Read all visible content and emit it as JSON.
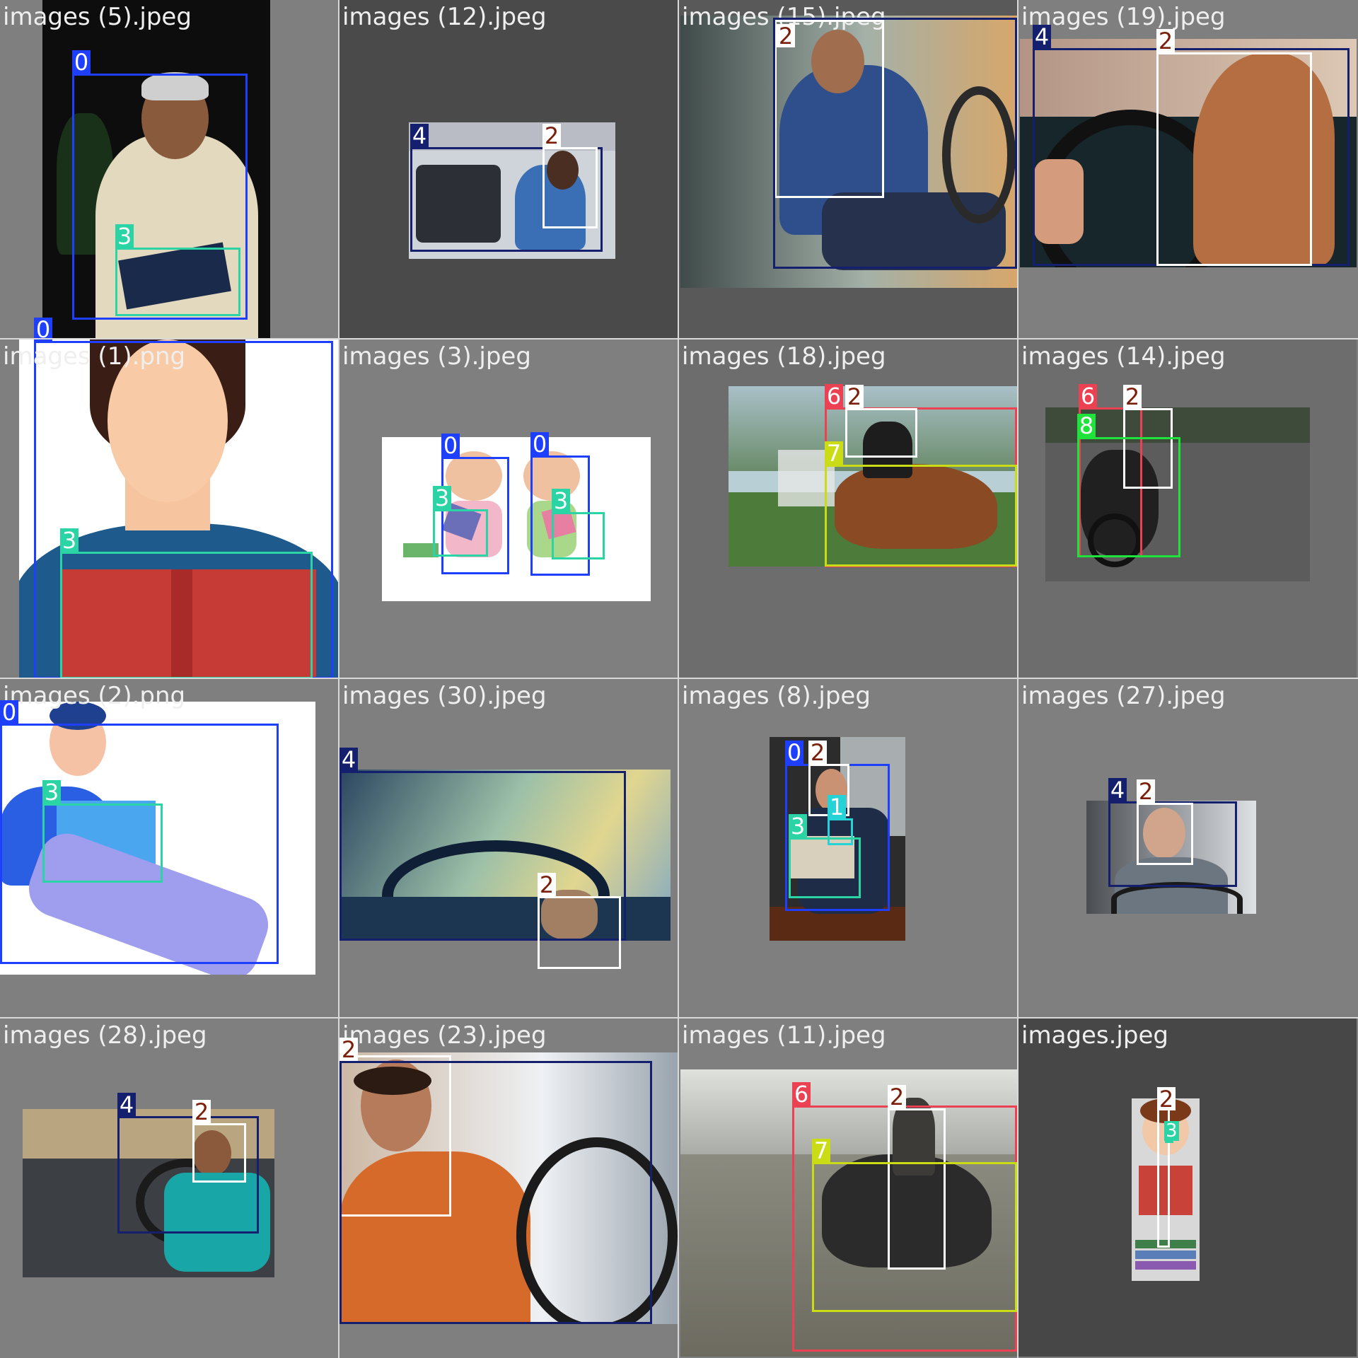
{
  "colors": {
    "0": "#1f3fff",
    "1": "#25d3d6",
    "2": "#ffffff",
    "3": "#2ad4a4",
    "4": "#14206e",
    "6": "#ec4152",
    "7": "#c9dc16",
    "8": "#1ee33a",
    "tag_text_2": "#7a1f0a",
    "bg": "#7f7f7f"
  },
  "cells": [
    {
      "filename": "images (5).jpeg",
      "boxes": [
        {
          "label": "0"
        },
        {
          "label": "3"
        }
      ]
    },
    {
      "filename": "images (12).jpeg",
      "boxes": [
        {
          "label": "4"
        },
        {
          "label": "2"
        }
      ]
    },
    {
      "filename": "images (15).jpeg",
      "boxes": [
        {
          "label": "2"
        }
      ]
    },
    {
      "filename": "images (19).jpeg",
      "boxes": [
        {
          "label": "4"
        },
        {
          "label": "2"
        }
      ]
    },
    {
      "filename": "images (1).png",
      "boxes": [
        {
          "label": "0"
        },
        {
          "label": "3"
        }
      ]
    },
    {
      "filename": "images (3).jpeg",
      "boxes": [
        {
          "label": "0"
        },
        {
          "label": "0"
        },
        {
          "label": "3"
        },
        {
          "label": "3"
        }
      ]
    },
    {
      "filename": "images (18).jpeg",
      "boxes": [
        {
          "label": "6"
        },
        {
          "label": "2"
        },
        {
          "label": "7"
        }
      ]
    },
    {
      "filename": "images (14).jpeg",
      "boxes": [
        {
          "label": "6"
        },
        {
          "label": "2"
        },
        {
          "label": "8"
        }
      ]
    },
    {
      "filename": "images (2).png",
      "boxes": [
        {
          "label": "0"
        },
        {
          "label": "3"
        }
      ]
    },
    {
      "filename": "images (30).jpeg",
      "boxes": [
        {
          "label": "4"
        },
        {
          "label": "2"
        }
      ]
    },
    {
      "filename": "images (8).jpeg",
      "boxes": [
        {
          "label": "0"
        },
        {
          "label": "2"
        },
        {
          "label": "1"
        },
        {
          "label": "3"
        }
      ]
    },
    {
      "filename": "images (27).jpeg",
      "boxes": [
        {
          "label": "4"
        },
        {
          "label": "2"
        }
      ]
    },
    {
      "filename": "images (28).jpeg",
      "boxes": [
        {
          "label": "4"
        },
        {
          "label": "2"
        }
      ]
    },
    {
      "filename": "images (23).jpeg",
      "boxes": [
        {
          "label": "2"
        },
        {
          "label": "4"
        }
      ]
    },
    {
      "filename": "images (11).jpeg",
      "boxes": [
        {
          "label": "6"
        },
        {
          "label": "2"
        },
        {
          "label": "7"
        }
      ]
    },
    {
      "filename": "images.jpeg",
      "boxes": [
        {
          "label": "2"
        },
        {
          "label": "3"
        }
      ]
    }
  ]
}
